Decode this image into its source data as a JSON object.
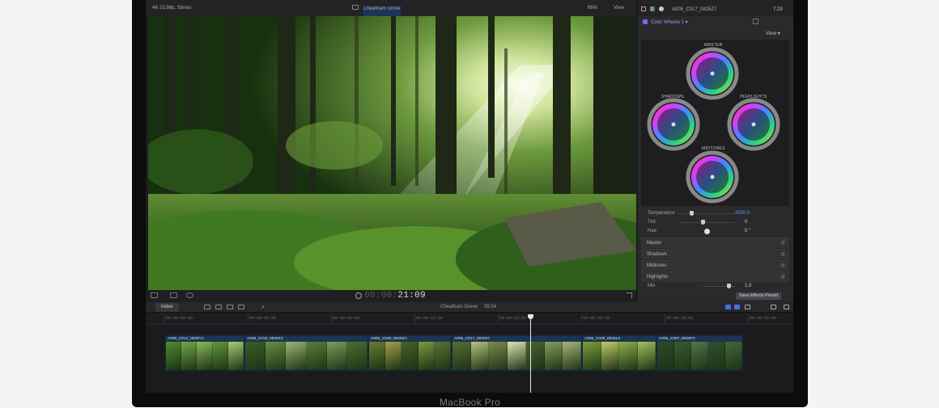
{
  "device_label": "MacBook Pro",
  "viewer": {
    "format": "4K 23.98p, Stereo",
    "clip_title": "Cheatham Grove",
    "zoom": "66%",
    "view_menu": "View",
    "timecode_dim": "00:00:",
    "timecode": "21:09"
  },
  "inspector": {
    "clip_name": "A005_C017_0825Z7",
    "duration": "7:23",
    "effect_name": "Color Wheels 1 ▾",
    "view_menu": "View ▾",
    "wheels": {
      "master": "MASTER",
      "shadows": "SHADOWS",
      "highlights": "HIGHLIGHTS",
      "midtones": "MIDTONES"
    },
    "params": [
      {
        "label": "Temperature",
        "value": "4500.0",
        "level": 0.2
      },
      {
        "label": "Tint",
        "value": "0",
        "level": 0.4
      },
      {
        "label": "Hue",
        "value": "0 °",
        "level": 0.5
      }
    ],
    "sections": [
      "Master",
      "Shadows",
      "Midtones",
      "Highlights"
    ],
    "mix": {
      "label": "Mix",
      "value": "1.0"
    },
    "save_preset": "Save Effects Preset"
  },
  "timeline": {
    "index_button": "Index",
    "project_name": "Cheatham Grove",
    "project_duration": "35:04",
    "ruler": [
      "00:00:00:00",
      "00:00:05:00",
      "00:00:10:00",
      "00:00:15:00",
      "00:00:20:00",
      "00:00:25:00",
      "00:00:30:00",
      "00:00:35:00"
    ],
    "clips": [
      {
        "name": "A005_C012_0825Y1"
      },
      {
        "name": "A005_C015_0825K3"
      },
      {
        "name": "A005_C026_0825ZC"
      },
      {
        "name": "A005_C017_0825Z7"
      },
      {
        "name": "A005_C028_0825L6"
      },
      {
        "name": "A005_C007_0825FX"
      }
    ]
  },
  "colors": {
    "accent_blue": "#6f8cff",
    "clip_border": "#0f2a48",
    "forest_light": "#c9e08a"
  }
}
